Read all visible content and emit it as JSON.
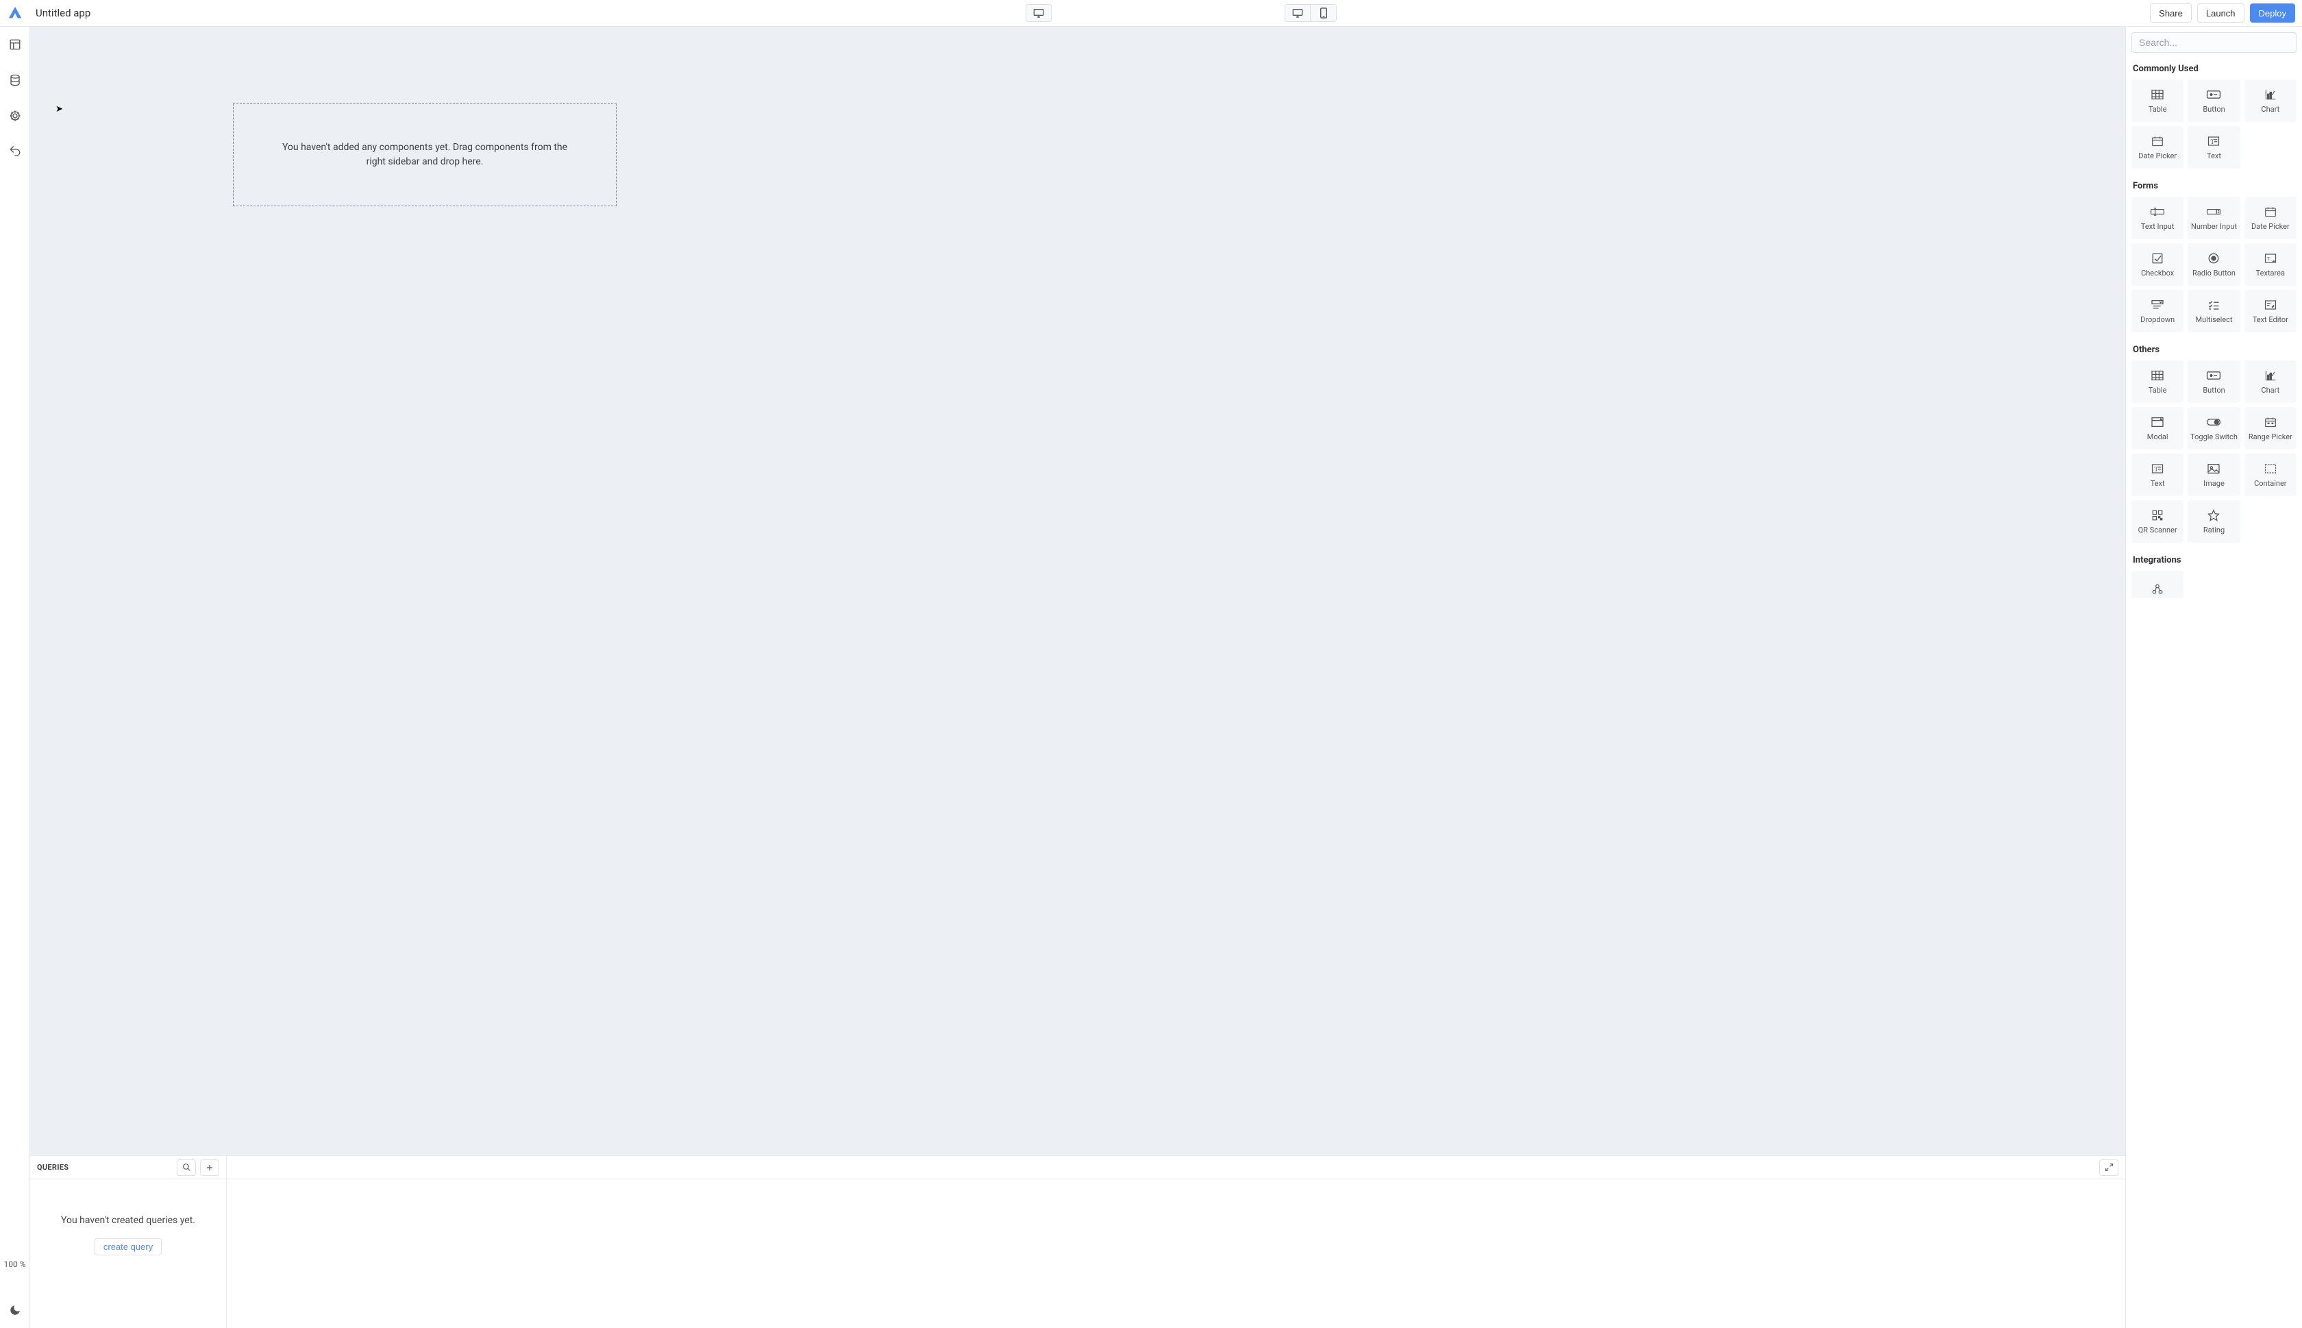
{
  "header": {
    "app_title": "Untitled app",
    "share_label": "Share",
    "launch_label": "Launch",
    "deploy_label": "Deploy"
  },
  "left_rail": {
    "zoom_label": "100 %"
  },
  "canvas": {
    "dropzone_text": "You haven't added any components yet. Drag components from the right sidebar and drop here."
  },
  "queries": {
    "title": "QUERIES",
    "empty_text": "You haven't created queries yet.",
    "create_label": "create query"
  },
  "right_sidebar": {
    "search_placeholder": "Search...",
    "sections": {
      "commonly_used": {
        "title": "Commonly Used",
        "items": [
          "Table",
          "Button",
          "Chart",
          "Date Picker",
          "Text"
        ]
      },
      "forms": {
        "title": "Forms",
        "items": [
          "Text Input",
          "Number Input",
          "Date Picker",
          "Checkbox",
          "Radio Button",
          "Textarea",
          "Dropdown",
          "Multiselect",
          "Text Editor"
        ]
      },
      "others": {
        "title": "Others",
        "items": [
          "Table",
          "Button",
          "Chart",
          "Modal",
          "Toggle Switch",
          "Range Picker",
          "Text",
          "Image",
          "Container",
          "QR Scanner",
          "Rating"
        ]
      },
      "integrations": {
        "title": "Integrations",
        "items": [
          ""
        ]
      }
    }
  }
}
